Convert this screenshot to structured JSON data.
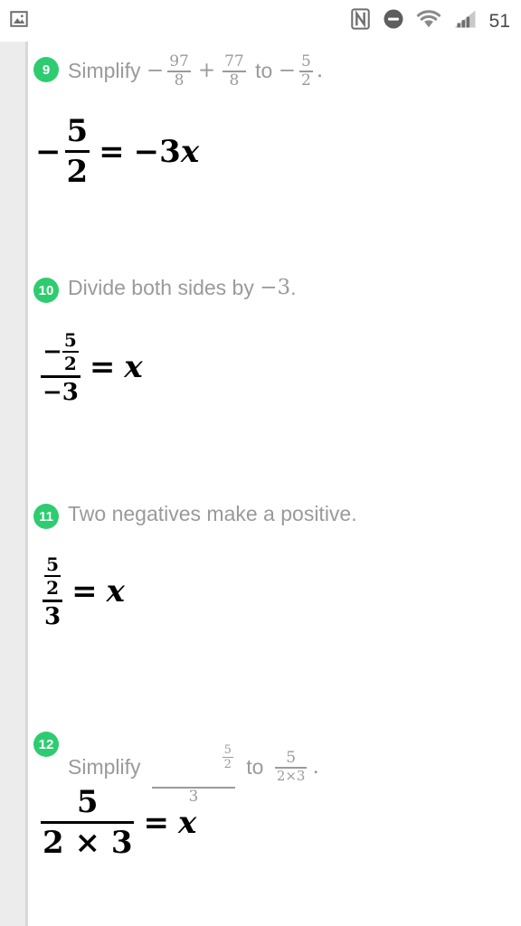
{
  "status_bar": {
    "left_icons": [
      {
        "name": "image-notification-icon",
        "label": "image"
      }
    ],
    "right_icons": [
      {
        "name": "nfc-icon",
        "label": "NFC"
      },
      {
        "name": "do-not-disturb-icon",
        "label": "Do not disturb"
      },
      {
        "name": "wifi-icon",
        "label": "Wi-Fi"
      },
      {
        "name": "cellular-signal-icon",
        "label": "Signal"
      }
    ],
    "battery_level": "51"
  },
  "theme": {
    "badge_green": "#2ecc71",
    "step_text_gray": "#9a9a9a",
    "equation_black": "#000000",
    "rail_gray": "#ececec",
    "divider_gray": "#d8d8d8",
    "background": "#ffffff"
  },
  "steps": [
    {
      "number": "9",
      "text_parts": {
        "lead": "Simplify ",
        "minus1": "−",
        "frac1_num": "97",
        "frac1_den": "8",
        "plus": "+",
        "frac2_num": "77",
        "frac2_den": "8",
        "mid": " to ",
        "minus2": "−",
        "frac3_num": "5",
        "frac3_den": "2",
        "end": "."
      },
      "equation": {
        "type": "fraction-equals-term",
        "lhs_sign": "−",
        "lhs_num": "5",
        "lhs_den": "2",
        "equals": "=",
        "rhs": "−3x",
        "rhs_sign": "−",
        "rhs_coeff": "3",
        "rhs_var": "x"
      }
    },
    {
      "number": "10",
      "text_parts": {
        "lead": "Divide both sides by ",
        "value": "−3",
        "end": "."
      },
      "equation": {
        "type": "nested-fraction-equals-var",
        "outer_num_sign": "−",
        "outer_num_frac_num": "5",
        "outer_num_frac_den": "2",
        "outer_den": "−3",
        "equals": "=",
        "rhs_var": "x"
      }
    },
    {
      "number": "11",
      "text_parts": {
        "lead": "Two negatives make a positive.",
        "value": "",
        "end": ""
      },
      "equation": {
        "type": "nested-fraction-equals-var",
        "outer_num_frac_num": "5",
        "outer_num_frac_den": "2",
        "outer_den": "3",
        "equals": "=",
        "rhs_var": "x"
      }
    },
    {
      "number": "12",
      "text_parts": {
        "lead": "Simplify ",
        "f1_num_num": "5",
        "f1_num_den": "2",
        "f1_den": "3",
        "mid": " to ",
        "f2_num": "5",
        "f2_den": "2×3",
        "end": "."
      },
      "equation": {
        "type": "fraction-equals-var",
        "num": "5",
        "den": "2 × 3",
        "equals": "=",
        "rhs_var": "x"
      }
    }
  ]
}
